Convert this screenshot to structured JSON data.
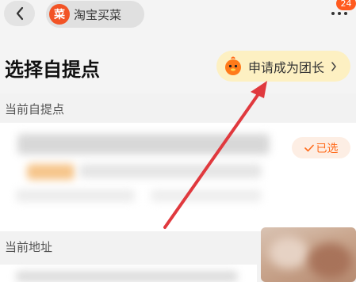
{
  "header": {
    "app_logo_text": "菜",
    "app_name": "淘宝买菜",
    "notification_count": "24"
  },
  "page": {
    "title": "选择自提点",
    "leader_button_label": "申请成为团长"
  },
  "current_pickup": {
    "section_label": "当前自提点",
    "selected_label": "已选"
  },
  "current_address": {
    "section_label": "当前地址"
  },
  "colors": {
    "accent_orange": "#ff6a1a",
    "logo_red": "#f25325",
    "leader_button_bg": "#fdf0c2",
    "annotation_arrow": "#e0393e"
  }
}
